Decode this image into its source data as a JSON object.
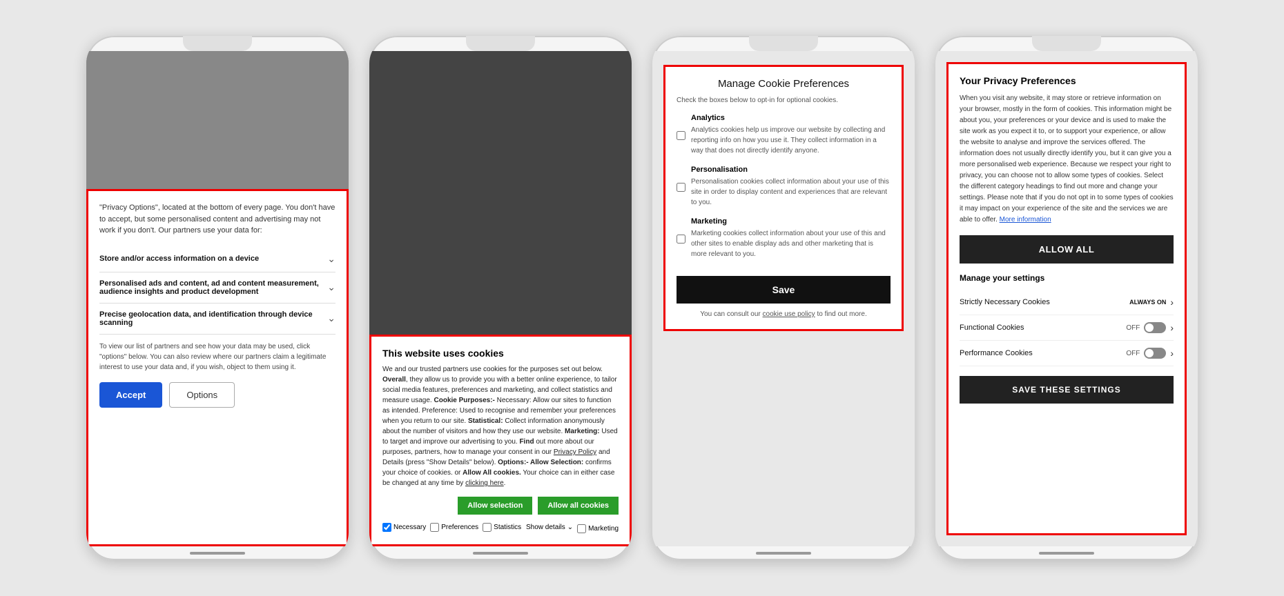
{
  "phone1": {
    "intro_text": "\"Privacy Options\", located at the bottom of every page. You don't have to accept, but some personalised content and advertising may not work if you don't. Our partners use your data for:",
    "accordions": [
      {
        "label": "Store and/or access information on a device"
      },
      {
        "label": "Personalised ads and content, ad and content measurement, audience insights and product development"
      },
      {
        "label": "Precise geolocation data, and identification through device scanning"
      }
    ],
    "footer_text": "To view our list of partners and see how your data may be used, click \"options\" below. You can also review where our partners claim a legitimate interest to use your data and, if you wish, object to them using it.",
    "accept_label": "Accept",
    "options_label": "Options"
  },
  "phone2": {
    "cookie_title": "This website uses cookies",
    "cookie_body_1": "We and our trusted partners use cookies for the purposes set out below. ",
    "cookie_body_bold1": "Overall",
    "cookie_body_2": ", they allow us to provide you with a better online experience, to tailor social media features, preferences and marketing, and collect statistics and measure usage. ",
    "cookie_body_bold2": "Cookie Purposes:-",
    "cookie_body_3": " Necessary: Allow our sites to function as intended. Preference: Used to recognise and remember your preferences when you return to our site. ",
    "cookie_body_bold3": "Statistical:",
    "cookie_body_4": " Collect information anonymously about the number of visitors and how they use our website. ",
    "cookie_body_bold4": "Marketing:",
    "cookie_body_5": " Used to target and improve our advertising to you. ",
    "cookie_body_bold5": "Find",
    "cookie_body_6": " out more about our purposes, partners, how to manage your consent in our Privacy Policy and Details (press \"Show Details\" below). ",
    "cookie_body_bold6": "Options:- Allow Selection:",
    "cookie_body_7": " confirms your choice of cookies. or ",
    "cookie_body_bold7": "Allow All cookies.",
    "cookie_body_8": " Your choice can in either case be changed at any time by clicking here.",
    "allow_selection_label": "Allow selection",
    "allow_all_label": "Allow all cookies",
    "checkboxes": [
      {
        "label": "Necessary",
        "checked": true
      },
      {
        "label": "Preferences",
        "checked": false
      },
      {
        "label": "Statistics",
        "checked": false
      },
      {
        "label": "Marketing",
        "checked": false
      }
    ],
    "show_details_label": "Show details"
  },
  "phone3": {
    "title": "Manage Cookie Preferences",
    "subtitle": "Check the boxes below to opt-in for optional cookies.",
    "options": [
      {
        "label": "Analytics",
        "description": "Analytics cookies help us improve our website by collecting and reporting info on how you use it. They collect information in a way that does not directly identify anyone.",
        "checked": false
      },
      {
        "label": "Personalisation",
        "description": "Personalisation cookies collect information about your use of this site in order to display content and experiences that are relevant to you.",
        "checked": false
      },
      {
        "label": "Marketing",
        "description": "Marketing cookies collect information about your use of this and other sites to enable display ads and other marketing that is more relevant to you.",
        "checked": false
      }
    ],
    "save_label": "Save",
    "footer_text": "You can consult our",
    "footer_link": "cookie use policy",
    "footer_text2": "to find out more."
  },
  "phone4": {
    "title": "Your Privacy Preferences",
    "body_text": "When you visit any website, it may store or retrieve information on your browser, mostly in the form of cookies. This information might be about you, your preferences or your device and is used to make the site work as you expect it to, or to support your experience, or allow the website to analyse and improve the services offered. The information does not usually directly identify you, but it can give you a more personalised web experience. Because we respect your right to privacy, you can choose not to allow some types of cookies. Select the different category headings to find out more and change your settings. Please note that if you do not opt in to some types of cookies it may impact on your experience of the site and the services we are able to offer.",
    "more_info_link": "More information",
    "allow_all_label": "ALLOW ALL",
    "manage_settings_title": "Manage your settings",
    "settings_rows": [
      {
        "label": "Strictly Necessary Cookies",
        "status": "ALWAYS ON",
        "is_always_on": true
      },
      {
        "label": "Functional Cookies",
        "status": "OFF",
        "is_always_on": false
      },
      {
        "label": "Performance Cookies",
        "status": "OFF",
        "is_always_on": false
      }
    ],
    "save_settings_label": "SAVE THESE SETTINGS"
  }
}
